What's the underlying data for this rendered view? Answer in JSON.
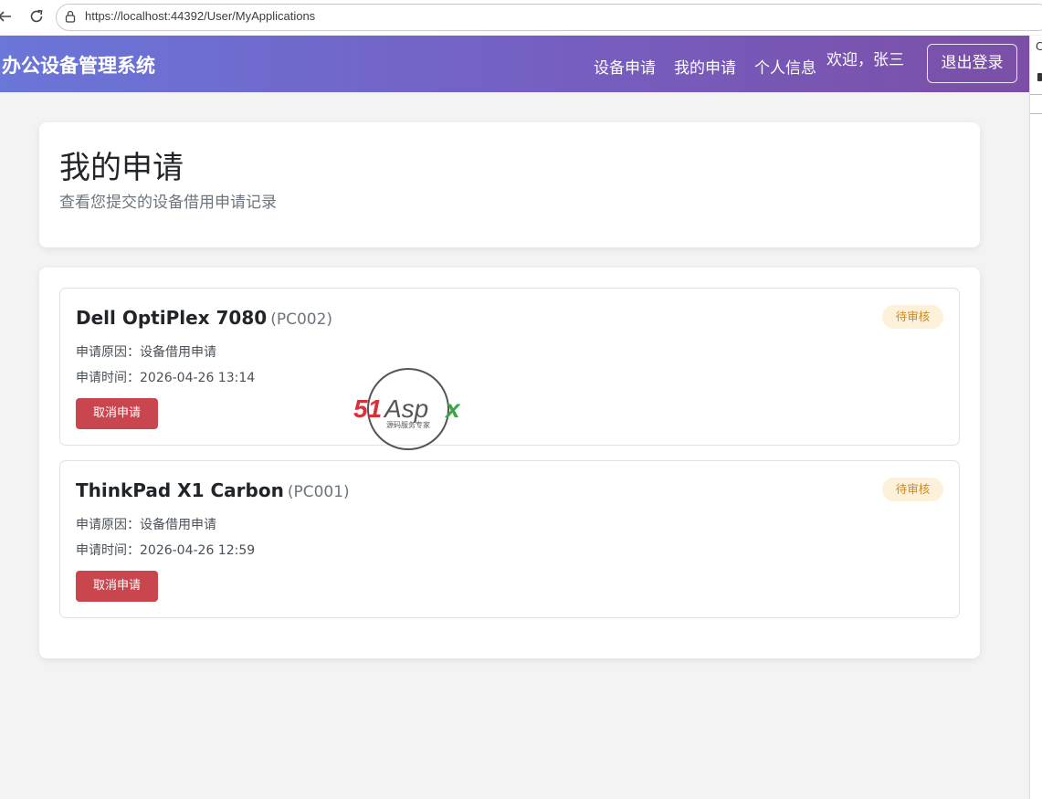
{
  "browser": {
    "url": "https://localhost:44392/User/MyApplications"
  },
  "navbar": {
    "brand": "办公设备管理系统",
    "links": [
      "设备申请",
      "我的申请",
      "个人信息"
    ],
    "welcome": "欢迎，张三",
    "logout_label": "退出登录"
  },
  "header": {
    "title": "我的申请",
    "subtitle": "查看您提交的设备借用申请记录"
  },
  "applications": [
    {
      "device_name": "Dell OptiPlex 7080",
      "device_code": "(PC002)",
      "status": "待审核",
      "reason_label": "申请原因：",
      "reason": "设备借用申请",
      "time_label": "申请时间：",
      "time": "2026-04-26 13:14",
      "cancel_label": "取消申请"
    },
    {
      "device_name": "ThinkPad X1 Carbon",
      "device_code": "(PC001)",
      "status": "待审核",
      "reason_label": "申请原因：",
      "reason": "设备借用申请",
      "time_label": "申请时间：",
      "time": "2026-04-26 12:59",
      "cancel_label": "取消申请"
    }
  ],
  "watermark": {
    "logo_text": "51Aspx",
    "tagline": "源码服务专家"
  },
  "colors": {
    "nav_gradient_start": "#6a76d8",
    "nav_gradient_end": "#7b4fa6",
    "badge_bg": "#fdf1dc",
    "badge_text": "#d08a21",
    "danger": "#c9464f"
  }
}
